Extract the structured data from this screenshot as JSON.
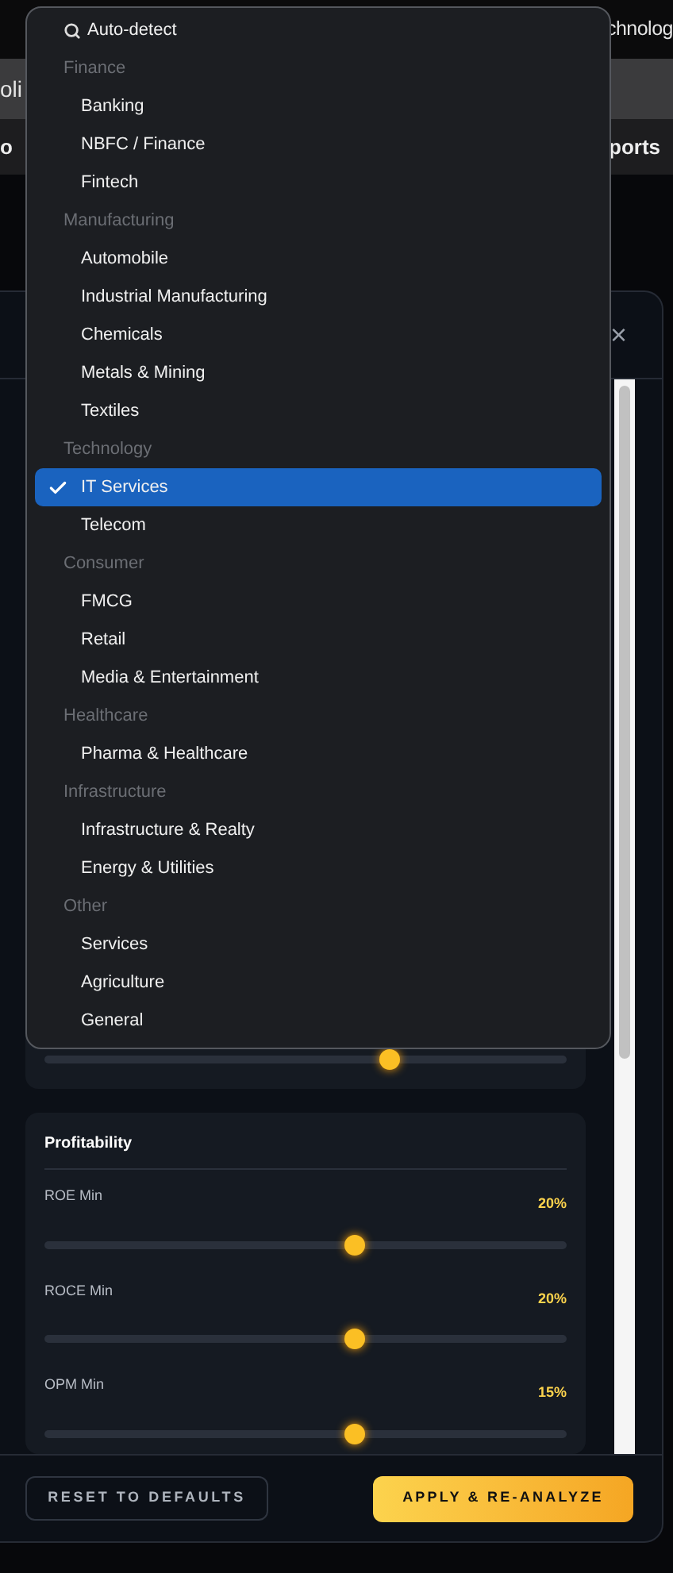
{
  "background": {
    "top_right_text": "chnolog",
    "tab_text": "oli",
    "nav_left_text": "o",
    "nav_right_text": "ports",
    "close_glyph": "×"
  },
  "dropdown": {
    "auto_detect": "Auto-detect",
    "groups": [
      {
        "label": "Finance",
        "items": [
          {
            "label": "Banking",
            "selected": false
          },
          {
            "label": "NBFC / Finance",
            "selected": false
          },
          {
            "label": "Fintech",
            "selected": false
          }
        ]
      },
      {
        "label": "Manufacturing",
        "items": [
          {
            "label": "Automobile",
            "selected": false
          },
          {
            "label": "Industrial Manufacturing",
            "selected": false
          },
          {
            "label": "Chemicals",
            "selected": false
          },
          {
            "label": "Metals & Mining",
            "selected": false
          },
          {
            "label": "Textiles",
            "selected": false
          }
        ]
      },
      {
        "label": "Technology",
        "items": [
          {
            "label": "IT Services",
            "selected": true
          },
          {
            "label": "Telecom",
            "selected": false
          }
        ]
      },
      {
        "label": "Consumer",
        "items": [
          {
            "label": "FMCG",
            "selected": false
          },
          {
            "label": "Retail",
            "selected": false
          },
          {
            "label": "Media & Entertainment",
            "selected": false
          }
        ]
      },
      {
        "label": "Healthcare",
        "items": [
          {
            "label": "Pharma & Healthcare",
            "selected": false
          }
        ]
      },
      {
        "label": "Infrastructure",
        "items": [
          {
            "label": "Infrastructure & Realty",
            "selected": false
          },
          {
            "label": "Energy & Utilities",
            "selected": false
          }
        ]
      },
      {
        "label": "Other",
        "items": [
          {
            "label": "Services",
            "selected": false
          },
          {
            "label": "Agriculture",
            "selected": false
          },
          {
            "label": "General",
            "selected": false
          }
        ]
      }
    ]
  },
  "covered_slider": {
    "level": 0.66
  },
  "profitability": {
    "title": "Profitability",
    "sliders": [
      {
        "label": "ROE Min",
        "reading": "20%",
        "level": 0.595
      },
      {
        "label": "ROCE Min",
        "reading": "20%",
        "level": 0.595
      },
      {
        "label": "OPM Min",
        "reading": "15%",
        "level": 0.595
      }
    ]
  },
  "buttons": {
    "reset": "RESET TO DEFAULTS",
    "apply": "APPLY & RE-ANALYZE"
  }
}
